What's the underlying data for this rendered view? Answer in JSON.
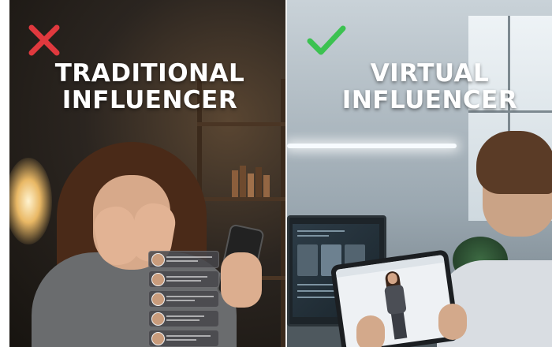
{
  "left": {
    "title_line1": "TRADITIONAL",
    "title_line2": "INFLUENCER",
    "mark_icon": "cross-icon",
    "mark_color": "#e0393e"
  },
  "right": {
    "title_line1": "VIRTUAL",
    "title_line2": "INFLUENCER",
    "mark_icon": "check-icon",
    "mark_color": "#3cc251"
  }
}
